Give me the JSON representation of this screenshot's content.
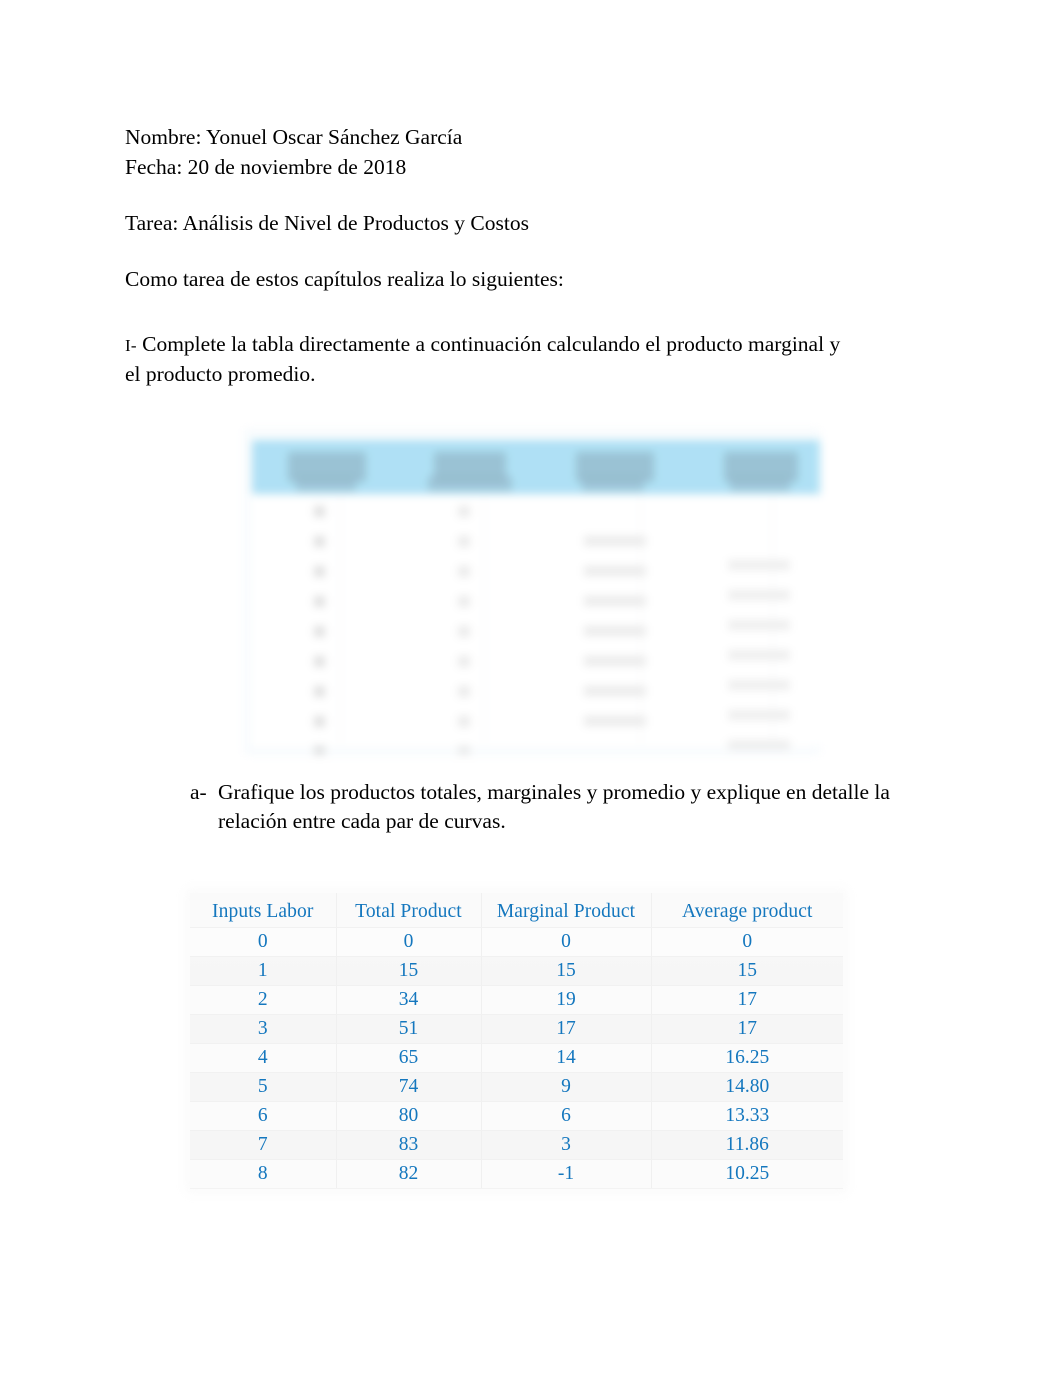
{
  "document": {
    "header_lines": [
      "Nombre: Yonuel Oscar Sánchez García",
      "Fecha: 20 de noviembre de 2018"
    ],
    "tarea_line": "Tarea: Análisis de Nivel de Productos y Costos",
    "intro_line": "Como tarea de estos capítulos realiza lo siguientes:",
    "instruction": {
      "marker": "I-",
      "text": " Complete la tabla directamente a continuación calculando el producto marginal y el producto promedio."
    },
    "list_item": {
      "marker": "a-",
      "text": "Grafique los productos totales, marginales y promedio y explique en detalle la relación entre cada par de curvas."
    }
  },
  "embedded_image": {
    "caption": "blurred-screenshot-of-production-table",
    "header_band_color": "#ade0f5"
  },
  "colors": {
    "table_text": "#1477be",
    "image_header_band": "#ade0f5",
    "page_background": "#ffffff"
  },
  "chart_data": {
    "type": "table",
    "title": "Inputs Labor / Total Product / Marginal Product / Average product",
    "columns": [
      "Inputs Labor",
      "Total Product",
      "Marginal Product",
      "Average product"
    ],
    "categories": [
      "0",
      "1",
      "2",
      "3",
      "4",
      "5",
      "6",
      "7",
      "8"
    ],
    "series": [
      {
        "name": "Inputs Labor",
        "values": [
          "0",
          "1",
          "2",
          "3",
          "4",
          "5",
          "6",
          "7",
          "8"
        ]
      },
      {
        "name": "Total Product",
        "values": [
          "0",
          "15",
          "34",
          "51",
          "65",
          "74",
          "80",
          "83",
          "82"
        ]
      },
      {
        "name": "Marginal Product",
        "values": [
          "0",
          "15",
          "19",
          "17",
          "14",
          "9",
          "6",
          "3",
          "-1"
        ]
      },
      {
        "name": "Average product",
        "values": [
          "0",
          "15",
          "17",
          "17",
          "16.25",
          "14.80",
          "13.33",
          "11.86",
          "10.25"
        ]
      }
    ],
    "rows": [
      [
        "0",
        "0",
        "0",
        "0"
      ],
      [
        "1",
        "15",
        "15",
        "15"
      ],
      [
        "2",
        "34",
        "19",
        "17"
      ],
      [
        "3",
        "51",
        "17",
        "17"
      ],
      [
        "4",
        "65",
        "14",
        "16.25"
      ],
      [
        "5",
        "74",
        "9",
        "14.80"
      ],
      [
        "6",
        "80",
        "6",
        "13.33"
      ],
      [
        "7",
        "83",
        "3",
        "11.86"
      ],
      [
        "8",
        "82",
        "-1",
        "10.25"
      ]
    ],
    "xlabel": "Inputs Labor",
    "ylabel": "",
    "grid": true,
    "legend": "none"
  }
}
